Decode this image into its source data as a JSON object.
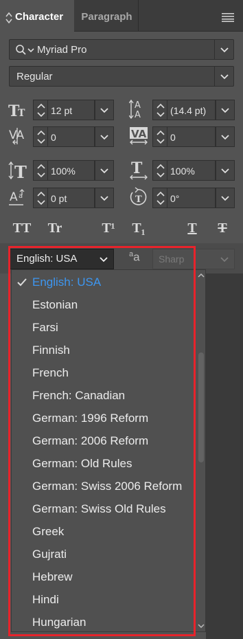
{
  "tabs": [
    {
      "label": "Character",
      "active": true
    },
    {
      "label": "Paragraph",
      "active": false
    }
  ],
  "font": {
    "family": "Myriad Pro",
    "style": "Regular"
  },
  "fields": {
    "font_size": "12 pt",
    "leading": "(14.4 pt)",
    "kerning": "0",
    "tracking": "0",
    "vertical_scale": "100%",
    "horizontal_scale": "100%",
    "baseline_shift": "0 pt",
    "rotation": "0°"
  },
  "type_styles": [
    "TT",
    "Tr",
    "T¹",
    "T₁",
    "T",
    "T"
  ],
  "language": {
    "selected": "English: USA",
    "options": [
      "English: USA",
      "Estonian",
      "Farsi",
      "Finnish",
      "French",
      "French: Canadian",
      "German: 1996 Reform",
      "German: 2006 Reform",
      "German: Old Rules",
      "German: Swiss 2006 Reform",
      "German: Swiss Old Rules",
      "Greek",
      "Gujrati",
      "Hebrew",
      "Hindi",
      "Hungarian"
    ]
  },
  "anti_alias": {
    "icon_text": "a",
    "icon_text_small": "a",
    "value": "Sharp"
  },
  "colors": {
    "panel_bg": "#535353",
    "selected_item": "#3d96f0",
    "highlight_border": "#e8232b"
  }
}
